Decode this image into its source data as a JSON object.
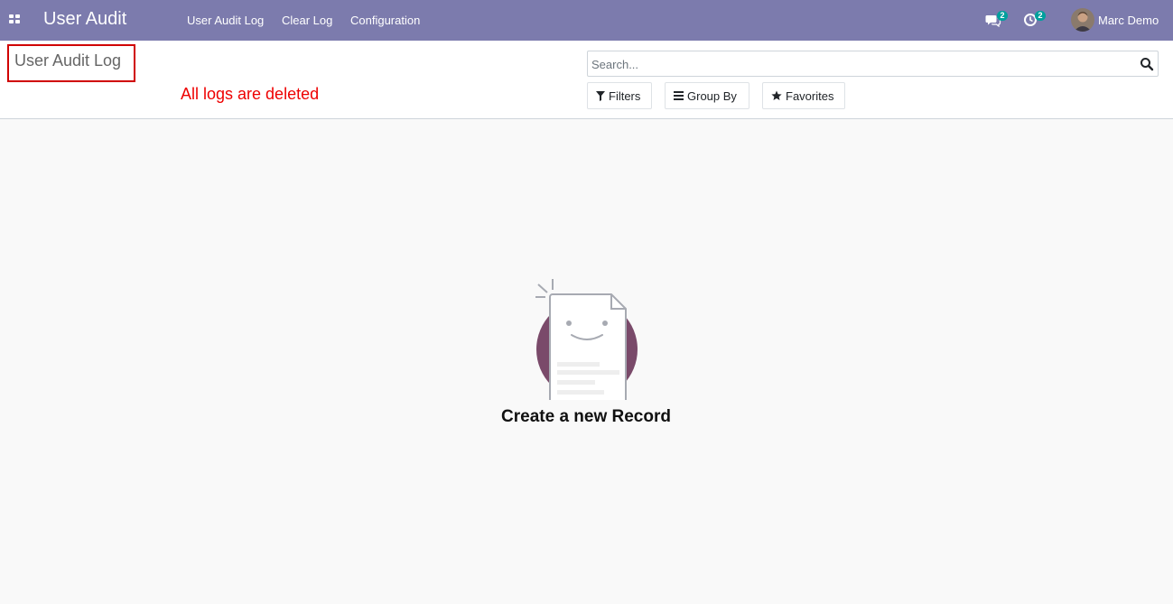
{
  "navbar": {
    "app_title": "User Audit",
    "menu": [
      {
        "label": "User Audit Log"
      },
      {
        "label": "Clear Log"
      },
      {
        "label": "Configuration"
      }
    ],
    "messages_count": "2",
    "activities_count": "2",
    "user_name": "Marc Demo"
  },
  "control_panel": {
    "title": "User Audit Log",
    "message": "All logs are deleted",
    "search": {
      "placeholder": "Search...",
      "value": ""
    },
    "buttons": {
      "filters": "Filters",
      "group_by": "Group By",
      "favorites": "Favorites"
    }
  },
  "empty_state": {
    "title": "Create a new Record"
  },
  "colors": {
    "navbar": "#7c7bad",
    "accent_badge": "#00a09d",
    "message_red": "#ee0000",
    "title_box_border": "#d00000",
    "illustration_circle": "#7a4a6a"
  }
}
